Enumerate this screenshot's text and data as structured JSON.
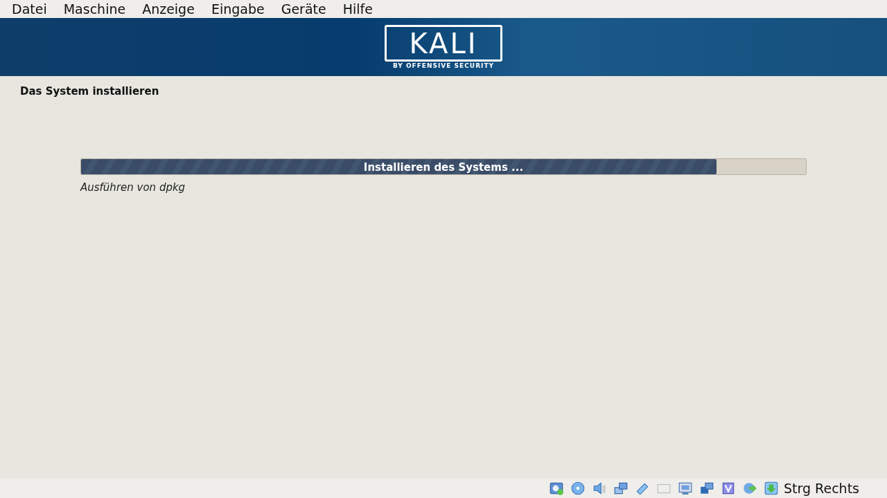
{
  "menu_bar": {
    "items": [
      "Datei",
      "Maschine",
      "Anzeige",
      "Eingabe",
      "Geräte",
      "Hilfe"
    ]
  },
  "banner": {
    "logo_text": "KALI",
    "logo_subtitle": "BY OFFENSIVE SECURITY"
  },
  "page": {
    "title": "Das System installieren"
  },
  "progress": {
    "label": "Installieren des Systems ...",
    "level": 0.877,
    "detail": "Ausführen von dpkg"
  },
  "status_bar": {
    "host_key": "Strg Rechts"
  }
}
